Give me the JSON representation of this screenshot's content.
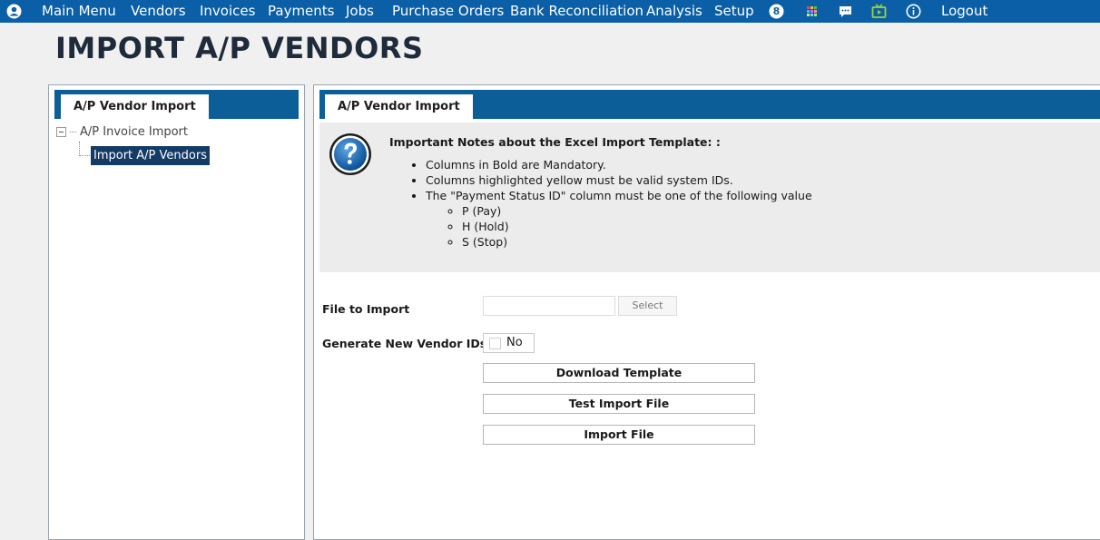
{
  "nav": {
    "items": [
      {
        "label": "Main Menu"
      },
      {
        "label": "Vendors"
      },
      {
        "label": "Invoices"
      },
      {
        "label": "Payments"
      },
      {
        "label": "Jobs"
      },
      {
        "label": "Purchase Orders"
      },
      {
        "label": "Bank Reconciliation"
      },
      {
        "label": "Analysis"
      },
      {
        "label": "Setup"
      }
    ],
    "badge_count": "8",
    "logout_label": "Logout",
    "icons": [
      "user-icon",
      "badge-icon",
      "apps-grid-icon",
      "chat-icon",
      "tv-icon",
      "info-icon"
    ]
  },
  "page": {
    "title": "IMPORT A/P VENDORS"
  },
  "left_panel": {
    "tab_label": "A/P Vendor Import",
    "tree": {
      "root_label": "A/P Invoice Import",
      "child_label": "Import A/P Vendors"
    }
  },
  "right_panel": {
    "tab_label": "A/P Vendor Import",
    "notes": {
      "title": "Important Notes about the Excel Import Template: :",
      "items": [
        "Columns in Bold are Mandatory.",
        "Columns highlighted yellow must be valid system IDs.",
        "The \"Payment Status ID\" column must be one of the following value"
      ],
      "sub_items": [
        "P (Pay)",
        "H (Hold)",
        "S (Stop)"
      ]
    },
    "form": {
      "file_label": "File to Import",
      "file_value": "",
      "select_label": "Select",
      "generate_label": "Generate New Vendor IDs",
      "generate_help": "?",
      "generate_value": "No",
      "download_label": "Download Template",
      "test_label": "Test Import File",
      "import_label": "Import File"
    }
  },
  "colors": {
    "nav_bg": "#0a5fa6",
    "panel_header": "#0b5e98",
    "selected_tree": "#143a66"
  }
}
